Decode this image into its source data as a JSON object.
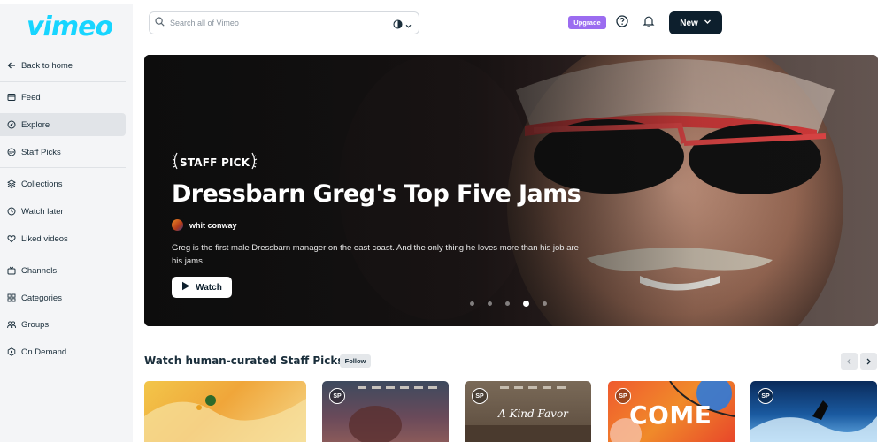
{
  "brand": {
    "logo_text": "vimeo",
    "logo_color": "#17d5ff"
  },
  "sidebar": {
    "back_label": "Back to home",
    "items": [
      {
        "label": "Feed",
        "icon": "feed-icon"
      },
      {
        "label": "Explore",
        "icon": "compass-icon",
        "active": true
      },
      {
        "label": "Staff Picks",
        "icon": "staff-picks-icon"
      },
      {
        "label": "Collections",
        "icon": "collections-icon"
      },
      {
        "label": "Watch later",
        "icon": "clock-icon"
      },
      {
        "label": "Liked videos",
        "icon": "heart-icon"
      },
      {
        "label": "Channels",
        "icon": "channels-icon"
      },
      {
        "label": "Categories",
        "icon": "categories-icon"
      },
      {
        "label": "Groups",
        "icon": "groups-icon"
      },
      {
        "label": "On Demand",
        "icon": "on-demand-icon"
      }
    ]
  },
  "topbar": {
    "search_placeholder": "Search all of Vimeo",
    "upgrade_label": "Upgrade",
    "new_label": "New"
  },
  "hero": {
    "badge": "STAFF PICK",
    "title": "Dressbarn Greg's Top Five Jams",
    "author": "whit conway",
    "description": "Greg is the first male Dressbarn manager on the east coast. And the only thing he loves more than his job are his jams.",
    "watch_label": "Watch",
    "slide_count": 5,
    "active_slide": 4
  },
  "section": {
    "title": "Watch human-curated Staff Picks",
    "follow_label": "Follow",
    "thumbnails": [
      {
        "badge": "",
        "caption": ""
      },
      {
        "badge": "SP",
        "caption": ""
      },
      {
        "badge": "SP",
        "caption": "A Kind Favor"
      },
      {
        "badge": "SP",
        "caption": "COME"
      },
      {
        "badge": "SP",
        "caption": ""
      }
    ]
  },
  "colors": {
    "accent_upgrade": "#9b6cf0",
    "dark_button": "#0d1f2d",
    "sidebar_bg": "#f4f5f7"
  }
}
